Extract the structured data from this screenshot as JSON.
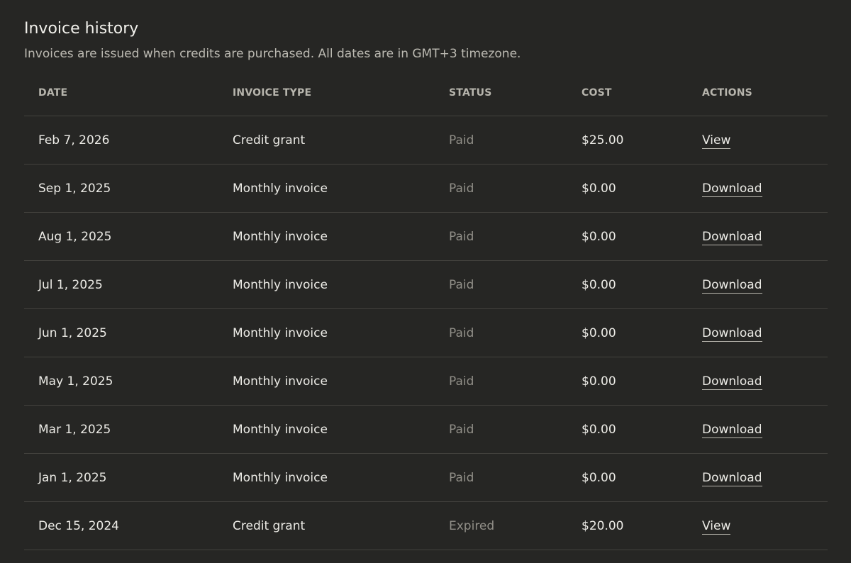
{
  "section": {
    "title": "Invoice history",
    "subtitle": "Invoices are issued when credits are purchased. All dates are in GMT+3 timezone."
  },
  "table": {
    "columns": [
      "DATE",
      "INVOICE TYPE",
      "STATUS",
      "COST",
      "ACTIONS"
    ],
    "rows": [
      {
        "date": "Feb 7, 2026",
        "type": "Credit grant",
        "status": "Paid",
        "cost": "$25.00",
        "action": "View"
      },
      {
        "date": "Sep 1, 2025",
        "type": "Monthly invoice",
        "status": "Paid",
        "cost": "$0.00",
        "action": "Download"
      },
      {
        "date": "Aug 1, 2025",
        "type": "Monthly invoice",
        "status": "Paid",
        "cost": "$0.00",
        "action": "Download"
      },
      {
        "date": "Jul 1, 2025",
        "type": "Monthly invoice",
        "status": "Paid",
        "cost": "$0.00",
        "action": "Download"
      },
      {
        "date": "Jun 1, 2025",
        "type": "Monthly invoice",
        "status": "Paid",
        "cost": "$0.00",
        "action": "Download"
      },
      {
        "date": "May 1, 2025",
        "type": "Monthly invoice",
        "status": "Paid",
        "cost": "$0.00",
        "action": "Download"
      },
      {
        "date": "Mar 1, 2025",
        "type": "Monthly invoice",
        "status": "Paid",
        "cost": "$0.00",
        "action": "Download"
      },
      {
        "date": "Jan 1, 2025",
        "type": "Monthly invoice",
        "status": "Paid",
        "cost": "$0.00",
        "action": "Download"
      },
      {
        "date": "Dec 15, 2024",
        "type": "Credit grant",
        "status": "Expired",
        "cost": "$20.00",
        "action": "View"
      }
    ]
  }
}
